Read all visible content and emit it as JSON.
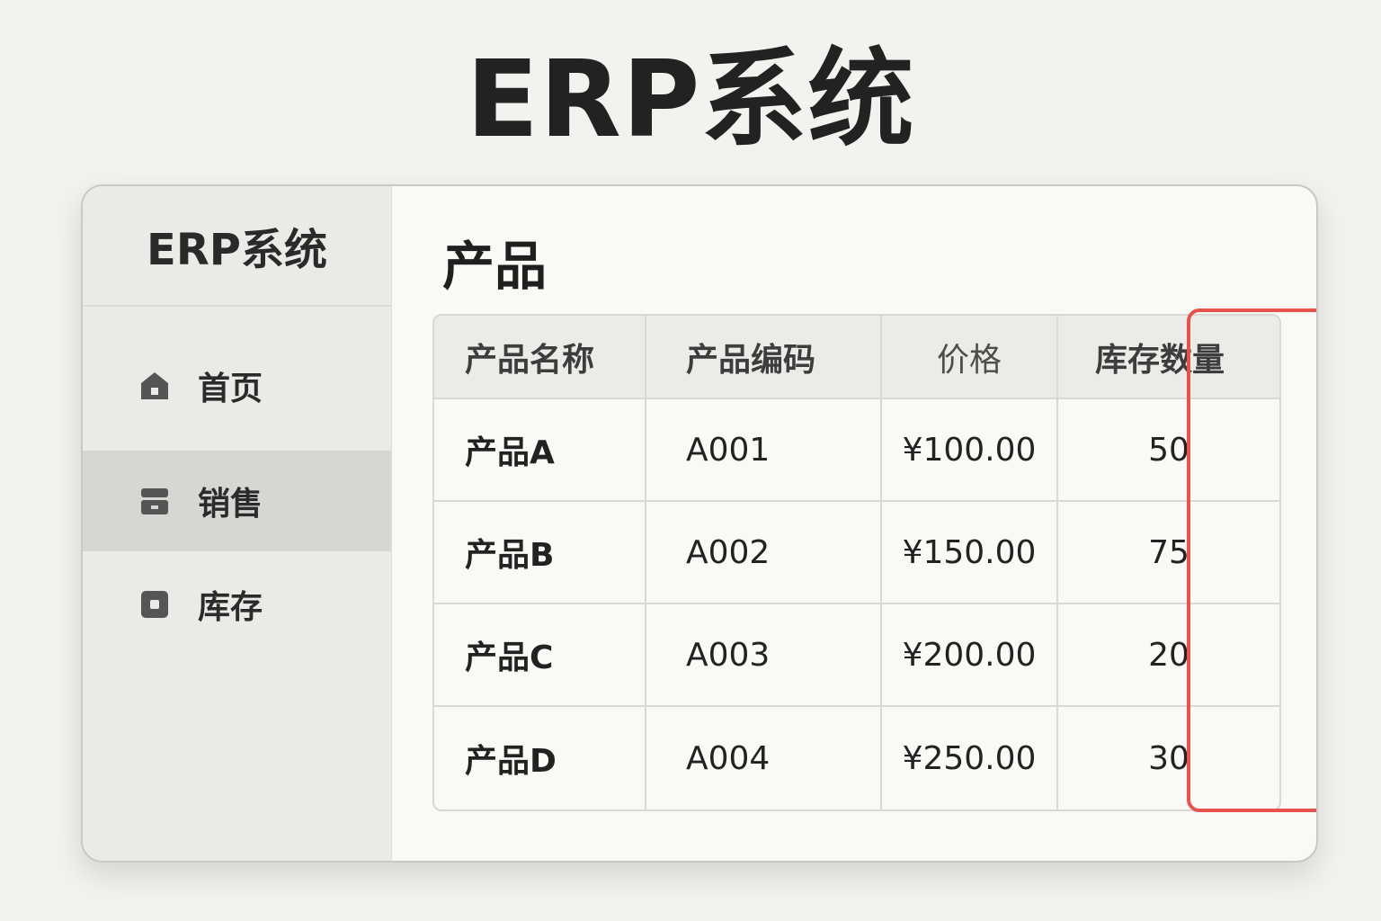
{
  "page": {
    "title": "ERP系统"
  },
  "sidebar": {
    "brand": "ERP系统",
    "items": [
      {
        "label": "首页",
        "icon": "home-icon",
        "active": false
      },
      {
        "label": "销售",
        "icon": "sales-icon",
        "active": true
      },
      {
        "label": "库存",
        "icon": "inventory-icon",
        "active": false
      }
    ]
  },
  "main": {
    "title": "产品",
    "table": {
      "headers": [
        "产品名称",
        "产品编码",
        "价格",
        "库存数量"
      ],
      "rows": [
        {
          "name": "产品A",
          "code": "A001",
          "price": "¥100.00",
          "stock": "50"
        },
        {
          "name": "产品B",
          "code": "A002",
          "price": "¥150.00",
          "stock": "75"
        },
        {
          "name": "产品C",
          "code": "A003",
          "price": "¥200.00",
          "stock": "20"
        },
        {
          "name": "产品D",
          "code": "A004",
          "price": "¥250.00",
          "stock": "30"
        }
      ],
      "highlight_column": "价格"
    }
  },
  "colors": {
    "background": "#f3f2ef",
    "sidebar": "#ebeae7",
    "active_nav": "#d7d6d3",
    "highlight": "#e5534b",
    "text": "#222222"
  }
}
